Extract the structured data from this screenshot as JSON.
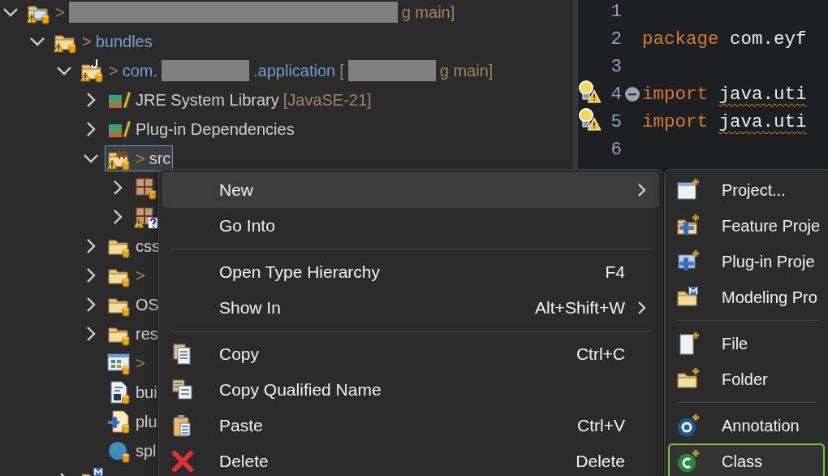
{
  "tree": [
    {
      "kind": "project",
      "expanded": true,
      "selected": false,
      "label": [
        {
          "kind": "decor",
          "text": ">"
        },
        {
          "kind": "redacted-wide"
        },
        {
          "kind": "branch",
          "text": "g main]"
        }
      ],
      "children": [
        {
          "kind": "bundle-folder",
          "expanded": true,
          "selected": false,
          "label": [
            {
              "kind": "decor",
              "text": ">"
            },
            {
              "kind": "project-name",
              "text": "bundles"
            }
          ],
          "children": [
            {
              "kind": "plugin-project",
              "expanded": true,
              "selected": false,
              "label": [
                {
                  "kind": "decor",
                  "text": ">"
                },
                {
                  "kind": "project-name",
                  "text": "com."
                },
                {
                  "kind": "redacted"
                },
                {
                  "kind": "project-name",
                  "text": ".application"
                },
                {
                  "kind": "branch",
                  "text": "["
                },
                {
                  "kind": "redacted"
                },
                {
                  "kind": "branch",
                  "text": "g main]"
                }
              ],
              "children": [
                {
                  "kind": "library",
                  "expanded": false,
                  "selected": false,
                  "label": [
                    {
                      "kind": "name",
                      "text": "JRE System Library"
                    },
                    {
                      "kind": "branch",
                      "text": "[JavaSE-21]"
                    }
                  ]
                },
                {
                  "kind": "library",
                  "expanded": false,
                  "selected": false,
                  "label": [
                    {
                      "kind": "name",
                      "text": "Plug-in Dependencies"
                    }
                  ]
                },
                {
                  "kind": "source-folder",
                  "expanded": true,
                  "selected": true,
                  "label": [
                    {
                      "kind": "decor",
                      "text": ">"
                    },
                    {
                      "kind": "name",
                      "text": "src"
                    }
                  ],
                  "children": [
                    {
                      "kind": "package",
                      "expanded": false,
                      "selected": false
                    },
                    {
                      "kind": "package-unknown",
                      "expanded": false,
                      "selected": false
                    }
                  ]
                },
                {
                  "kind": "folder",
                  "expanded": false,
                  "selected": false,
                  "label": [
                    {
                      "kind": "name",
                      "text": "css"
                    }
                  ]
                },
                {
                  "kind": "folder",
                  "expanded": false,
                  "selected": false,
                  "label": [
                    {
                      "kind": "decor",
                      "text": ">"
                    }
                  ]
                },
                {
                  "kind": "folder",
                  "expanded": false,
                  "selected": false,
                  "label": [
                    {
                      "kind": "name",
                      "text": "OS"
                    }
                  ]
                },
                {
                  "kind": "folder",
                  "expanded": false,
                  "selected": false,
                  "label": [
                    {
                      "kind": "name",
                      "text": "res"
                    }
                  ]
                },
                {
                  "kind": "app-model",
                  "selected": false,
                  "label": [
                    {
                      "kind": "decor",
                      "text": ">"
                    }
                  ]
                },
                {
                  "kind": "build-file",
                  "selected": false,
                  "label": [
                    {
                      "kind": "name",
                      "text": "bui"
                    }
                  ]
                },
                {
                  "kind": "plugin-file",
                  "selected": false,
                  "label": [
                    {
                      "kind": "name",
                      "text": "plu"
                    }
                  ]
                },
                {
                  "kind": "globe-file",
                  "selected": false,
                  "label": [
                    {
                      "kind": "name",
                      "text": "spl"
                    }
                  ]
                }
              ]
            },
            {
              "kind": "model-project",
              "expanded": false,
              "selected": false
            }
          ]
        }
      ]
    }
  ],
  "editor": {
    "lines": [
      {
        "number": "1"
      },
      {
        "number": "2",
        "code": [
          {
            "kind": "keyword",
            "text": "package"
          },
          {
            "kind": "plain",
            "text": "com.eyf"
          }
        ]
      },
      {
        "number": "3"
      },
      {
        "number": "4",
        "warning": true,
        "expanded": true,
        "code": [
          {
            "kind": "keyword",
            "text": "import"
          },
          {
            "kind": "flagged",
            "text": "java.uti"
          }
        ]
      },
      {
        "number": "5",
        "warning": true,
        "code": [
          {
            "kind": "keyword",
            "text": "import"
          },
          {
            "kind": "flagged",
            "text": "java.uti"
          }
        ]
      },
      {
        "number": "6"
      }
    ]
  },
  "context_menu": {
    "items": [
      {
        "kind": "item",
        "label": "New",
        "submenu": true,
        "selected": true
      },
      {
        "kind": "item",
        "label": "Go Into",
        "submenu": false,
        "selected": false
      },
      {
        "kind": "separator"
      },
      {
        "kind": "item",
        "label": "Open Type Hierarchy",
        "shortcut": "F4",
        "submenu": false,
        "selected": false
      },
      {
        "kind": "item",
        "label": "Show In",
        "shortcut": "Alt+Shift+W",
        "submenu": true,
        "selected": false
      },
      {
        "kind": "separator"
      },
      {
        "kind": "item",
        "label": "Copy",
        "shortcut": "Ctrl+C",
        "submenu": false,
        "selected": false
      },
      {
        "kind": "item",
        "label": "Copy Qualified Name",
        "submenu": false,
        "selected": false
      },
      {
        "kind": "item",
        "label": "Paste",
        "shortcut": "Ctrl+V",
        "submenu": false,
        "selected": false
      },
      {
        "kind": "item",
        "label": "Delete",
        "shortcut": "Delete",
        "submenu": false,
        "selected": false
      }
    ]
  },
  "new_submenu": {
    "items": [
      {
        "kind": "item",
        "label": "Project...",
        "selected": false
      },
      {
        "kind": "item",
        "label": "Feature Proje",
        "selected": false
      },
      {
        "kind": "item",
        "label": "Plug-in Proje",
        "selected": false
      },
      {
        "kind": "item",
        "label": "Modeling Pro",
        "selected": false
      },
      {
        "kind": "separator"
      },
      {
        "kind": "item",
        "label": "File",
        "selected": false
      },
      {
        "kind": "item",
        "label": "Folder",
        "selected": false
      },
      {
        "kind": "separator"
      },
      {
        "kind": "item",
        "label": "Annotation",
        "selected": false
      },
      {
        "kind": "item",
        "label": "Class",
        "selected": true
      }
    ]
  }
}
